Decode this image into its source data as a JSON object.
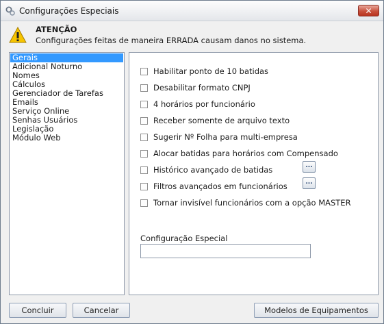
{
  "window": {
    "title": "Configurações Especiais",
    "close_label": "✕"
  },
  "warning": {
    "title": "ATENÇÃO",
    "message": "Configurações feitas de maneira ERRADA causam danos no sistema."
  },
  "sidebar": {
    "items": [
      {
        "label": "Gerais",
        "selected": true
      },
      {
        "label": "Adicional Noturno"
      },
      {
        "label": "Nomes"
      },
      {
        "label": "Cálculos"
      },
      {
        "label": "Gerenciador de Tarefas"
      },
      {
        "label": "Emails"
      },
      {
        "label": "Serviço Online"
      },
      {
        "label": "Senhas Usuários"
      },
      {
        "label": "Legislação"
      },
      {
        "label": "Módulo Web"
      }
    ]
  },
  "options": [
    {
      "label": "Habilitar ponto de 10 batidas",
      "checked": false
    },
    {
      "label": "Desabilitar formato CNPJ",
      "checked": false
    },
    {
      "label": "4 horários por funcionário",
      "checked": false
    },
    {
      "label": "Receber somente de arquivo texto",
      "checked": false
    },
    {
      "label": "Sugerir Nº Folha para multi-empresa",
      "checked": false
    },
    {
      "label": "Alocar batidas para horários com Compensado",
      "checked": false
    },
    {
      "label": "Histórico avançado de batidas",
      "checked": false,
      "more_label": "..."
    },
    {
      "label": "Filtros avançados em funcionários",
      "checked": false,
      "more_label": "..."
    },
    {
      "label": "Tornar invisível funcionários com a opção MASTER",
      "checked": false
    }
  ],
  "special_config": {
    "label": "Configuração Especial",
    "value": ""
  },
  "buttons": {
    "concluir": "Concluir",
    "cancelar": "Cancelar",
    "modelos": "Modelos de Equipamentos"
  }
}
